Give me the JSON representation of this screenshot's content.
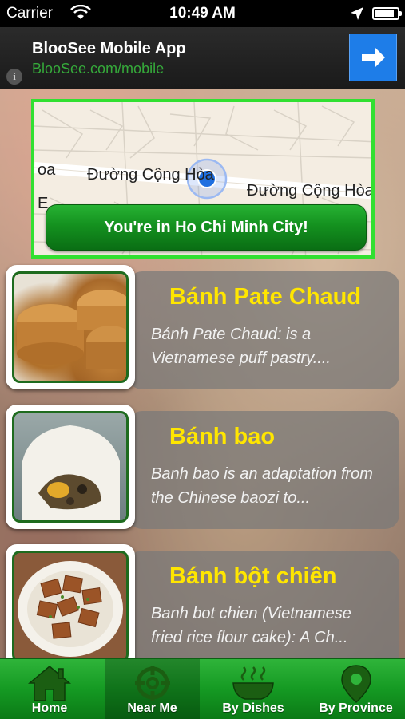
{
  "status_bar": {
    "carrier": "Carrier",
    "time": "10:49 AM",
    "battery_level": 0.9
  },
  "ad": {
    "title": "BlooSee Mobile App",
    "url": "BlooSee.com/mobile",
    "info_glyph": "i",
    "cta_icon": "arrow-right-icon",
    "accent": "#1e7de8",
    "url_color": "#35a93a"
  },
  "map": {
    "road_left": "oa",
    "road_mid": "Đường Cộng Hòa",
    "road_right": "Đường Cộng Hòa",
    "road_edge": "E",
    "location_button": "You're in Ho Chi Minh City!",
    "border_color": "#31e031"
  },
  "dishes": [
    {
      "name": "Bánh Pate Chaud",
      "description": "Bánh Pate Chaud: is a Vietnamese puff pastry...."
    },
    {
      "name": "Bánh bao",
      "description": "Banh bao is an adaptation from the Chinese baozi to..."
    },
    {
      "name": "Bánh bột chiên",
      "description": "Banh bot chien (Vietnamese fried rice flour cake): A Ch..."
    }
  ],
  "tabs": [
    {
      "label": "Home",
      "icon": "home-icon"
    },
    {
      "label": "Near Me",
      "icon": "crosshair-icon",
      "active": true
    },
    {
      "label": "By Dishes",
      "icon": "bowl-icon"
    },
    {
      "label": "By Province",
      "icon": "map-pin-icon"
    }
  ],
  "colors": {
    "dish_title": "#ffe600",
    "tab_green": "#159a23"
  }
}
